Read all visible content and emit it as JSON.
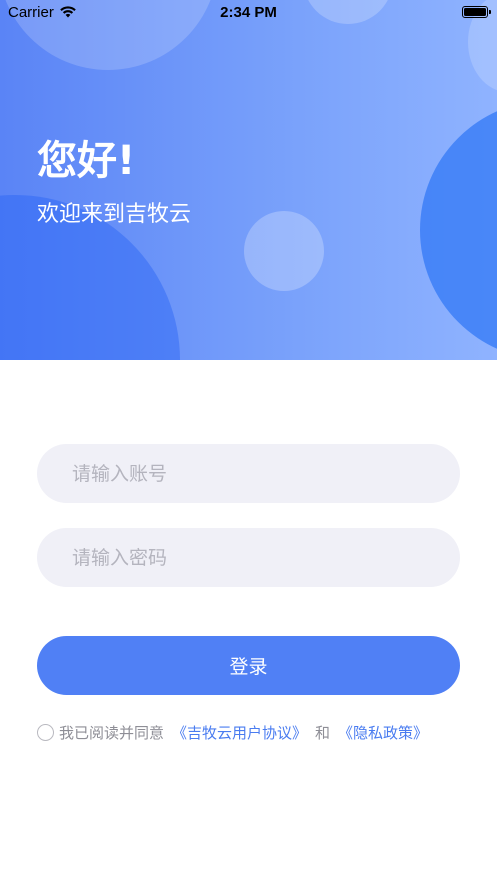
{
  "status_bar": {
    "carrier": "Carrier",
    "time": "2:34 PM",
    "icons": [
      "wifi-icon",
      "battery-icon"
    ]
  },
  "hero": {
    "greeting": "您好!",
    "welcome": "欢迎来到吉牧云"
  },
  "form": {
    "account_placeholder": "请输入账号",
    "password_placeholder": "请输入密码",
    "login_label": "登录"
  },
  "agreement": {
    "prefix": "我已阅读并同意",
    "user_agreement_link": "《吉牧云用户协议》",
    "and": "和",
    "privacy_link": "《隐私政策》"
  },
  "colors": {
    "primary": "#5080f5",
    "link": "#4a7cf0",
    "input_bg": "#f0f0f7",
    "placeholder": "#b4b4be"
  }
}
